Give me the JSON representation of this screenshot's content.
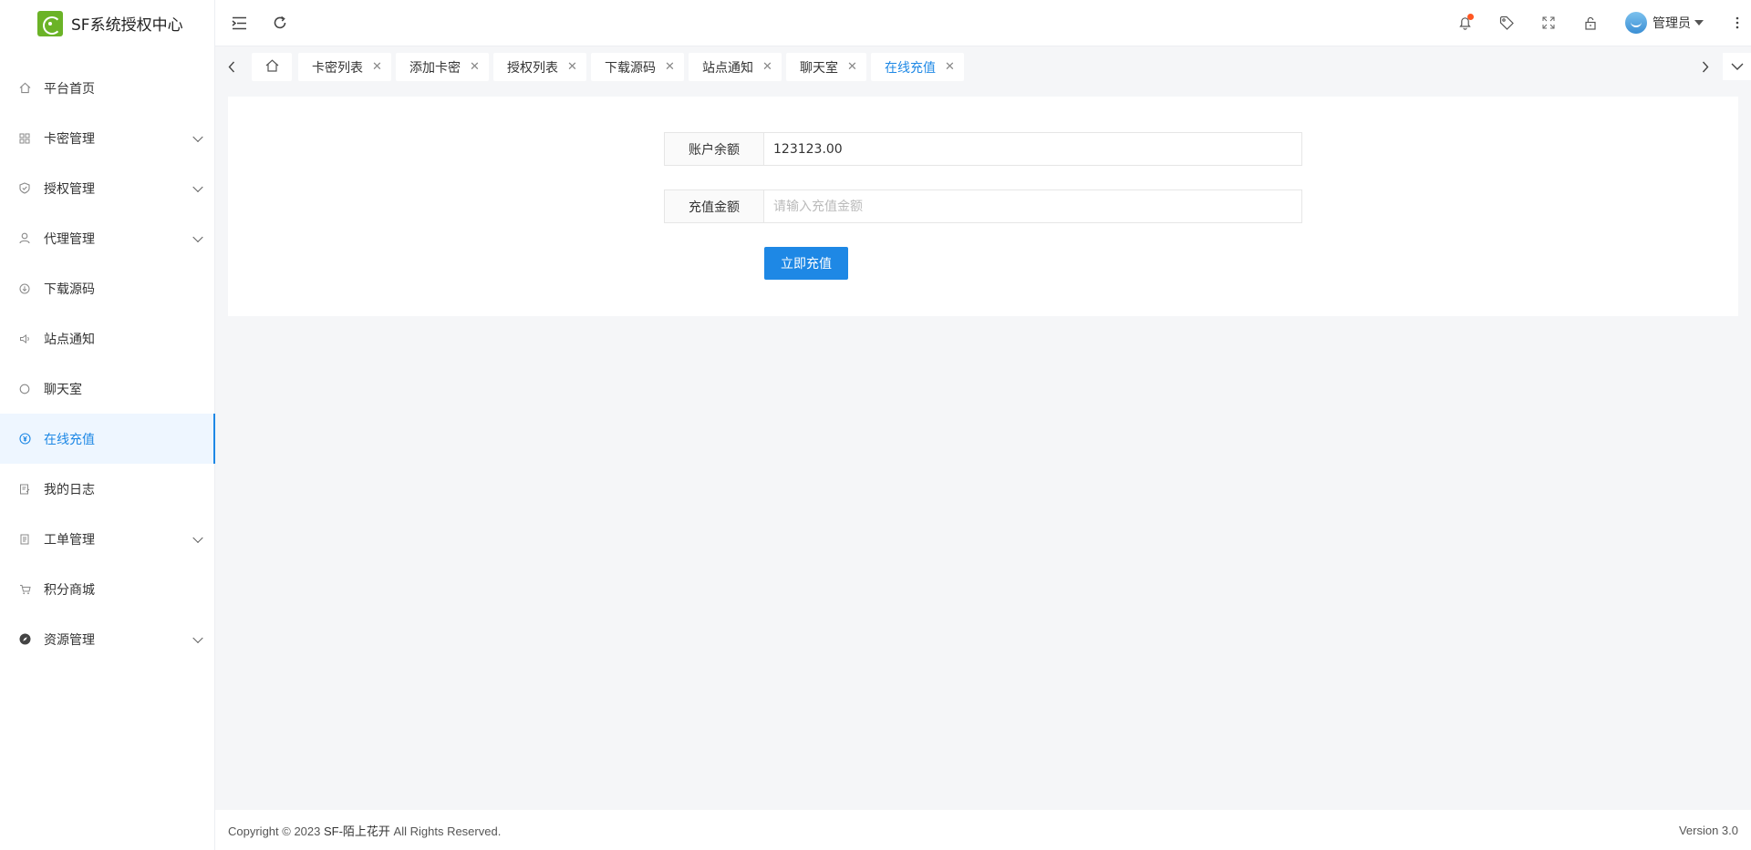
{
  "app": {
    "title": "SF系统授权中心"
  },
  "sidebar": {
    "items": [
      {
        "label": "平台首页",
        "icon": "home-icon",
        "expandable": false,
        "active": false
      },
      {
        "label": "卡密管理",
        "icon": "grid-icon",
        "expandable": true,
        "active": false
      },
      {
        "label": "授权管理",
        "icon": "shield-icon",
        "expandable": true,
        "active": false
      },
      {
        "label": "代理管理",
        "icon": "user-icon",
        "expandable": true,
        "active": false
      },
      {
        "label": "下载源码",
        "icon": "download-icon",
        "expandable": false,
        "active": false
      },
      {
        "label": "站点通知",
        "icon": "speaker-icon",
        "expandable": false,
        "active": false
      },
      {
        "label": "聊天室",
        "icon": "chat-icon",
        "expandable": false,
        "active": false
      },
      {
        "label": "在线充值",
        "icon": "yen-icon",
        "expandable": false,
        "active": true
      },
      {
        "label": "我的日志",
        "icon": "log-icon",
        "expandable": false,
        "active": false
      },
      {
        "label": "工单管理",
        "icon": "ticket-icon",
        "expandable": true,
        "active": false
      },
      {
        "label": "积分商城",
        "icon": "cart-icon",
        "expandable": false,
        "active": false
      },
      {
        "label": "资源管理",
        "icon": "compass-icon",
        "expandable": true,
        "active": false
      }
    ]
  },
  "header": {
    "user_name": "管理员",
    "icons": [
      "menu-fold-icon",
      "refresh-icon",
      "bell-icon",
      "tag-icon",
      "fullscreen-icon",
      "lock-icon",
      "more-icon"
    ]
  },
  "tabs": [
    {
      "label": "卡密列表"
    },
    {
      "label": "添加卡密"
    },
    {
      "label": "授权列表"
    },
    {
      "label": "下载源码"
    },
    {
      "label": "站点通知"
    },
    {
      "label": "聊天室"
    },
    {
      "label": "在线充值",
      "active": true
    }
  ],
  "form": {
    "balance_label": "账户余额",
    "balance_value": "123123.00",
    "amount_label": "充值金额",
    "amount_placeholder": "请输入充值金额",
    "submit_label": "立即充值"
  },
  "footer": {
    "prefix": "Copyright © 2023 ",
    "brand": "SF-陌上花开",
    "suffix": " All Rights Reserved.",
    "version": "Version 3.0"
  },
  "colors": {
    "accent": "#1e88e5",
    "logo": "#6bb327",
    "badge": "#ff5722"
  }
}
